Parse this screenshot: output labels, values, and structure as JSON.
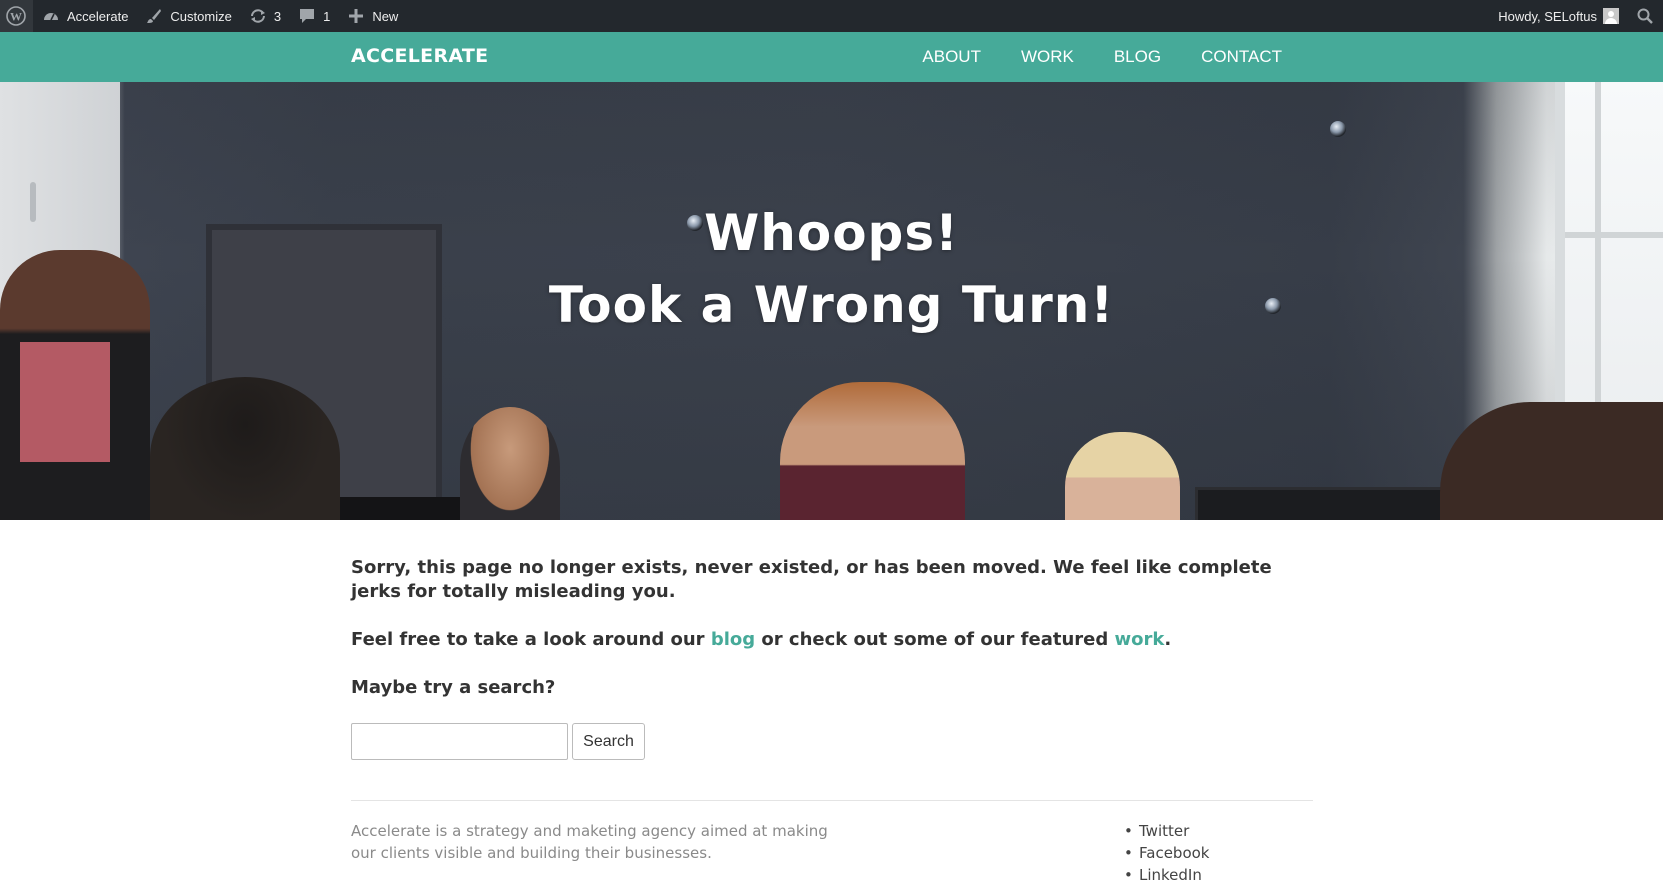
{
  "admin_bar": {
    "site_name": "Accelerate",
    "customize_label": "Customize",
    "updates_count": "3",
    "comments_count": "1",
    "new_label": "New",
    "howdy_label": "Howdy, SELoftus",
    "icons": [
      "wordpress-icon",
      "dashboard-icon",
      "brush-icon",
      "updates-icon",
      "comment-icon",
      "plus-icon",
      "search-icon"
    ]
  },
  "header": {
    "site_title": "ACCELERATE",
    "nav": [
      "ABOUT",
      "WORK",
      "BLOG",
      "CONTACT"
    ]
  },
  "hero": {
    "line1": "Whoops!",
    "line2": "Took a Wrong Turn!"
  },
  "content": {
    "sorry_text": "Sorry, this page no longer exists, never existed, or has been moved. We feel like complete jerks for totally misleading you.",
    "feel_prefix": "Feel free to take a look around our ",
    "blog_link": "blog",
    "feel_middle": " or check out some of our featured ",
    "work_link": "work",
    "feel_suffix": ".",
    "maybe_text": "Maybe try a search?",
    "search_value": "",
    "search_button": "Search"
  },
  "footer": {
    "about_text": "Accelerate is a strategy and maketing agency aimed at making our clients visible and building their businesses.",
    "social": [
      "Twitter",
      "Facebook",
      "LinkedIn"
    ]
  },
  "colors": {
    "admin_bar_bg": "#23282d",
    "brand_teal": "#46aa99",
    "text_dark": "#333333",
    "footer_muted": "#8a8a8a"
  }
}
